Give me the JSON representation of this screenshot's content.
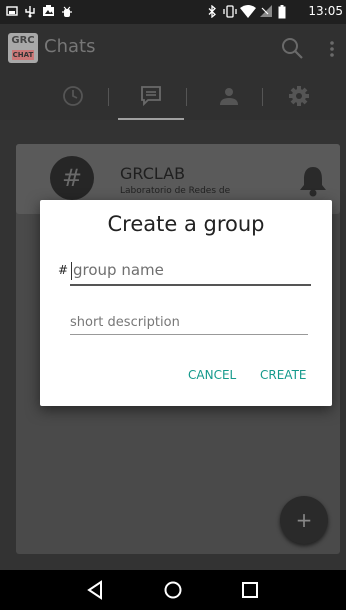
{
  "status_bar": {
    "time": "13:05",
    "icons": [
      "screenshot-icon",
      "usb-icon",
      "image-icon",
      "debug-icon",
      "bluetooth-icon",
      "vibrate-icon",
      "wifi-icon",
      "no-signal-icon",
      "battery-icon"
    ]
  },
  "toolbar": {
    "logo_line1": "GRC",
    "logo_line2": "CHAT",
    "title": "Chats",
    "icons": [
      "search-icon",
      "overflow-menu-icon"
    ]
  },
  "tabs": [
    {
      "icon": "clock-icon",
      "selected": false
    },
    {
      "icon": "chat-icon",
      "selected": true
    },
    {
      "icon": "person-icon",
      "selected": false
    },
    {
      "icon": "settings-icon",
      "selected": false
    }
  ],
  "chat_item": {
    "avatar_symbol": "#",
    "title": "GRCLAB",
    "subtitle": "Laboratorio de Redes de",
    "icon": "bell-icon"
  },
  "fab": {
    "label": "+"
  },
  "dialog": {
    "title": "Create a group",
    "hash": "#",
    "group_name_placeholder": "group name",
    "short_description_placeholder": "short description",
    "cancel_label": "CANCEL",
    "create_label": "CREATE",
    "accent_color": "#159a8c"
  },
  "nav_bar": {
    "icons": [
      "back-icon",
      "home-icon",
      "recents-icon"
    ]
  }
}
